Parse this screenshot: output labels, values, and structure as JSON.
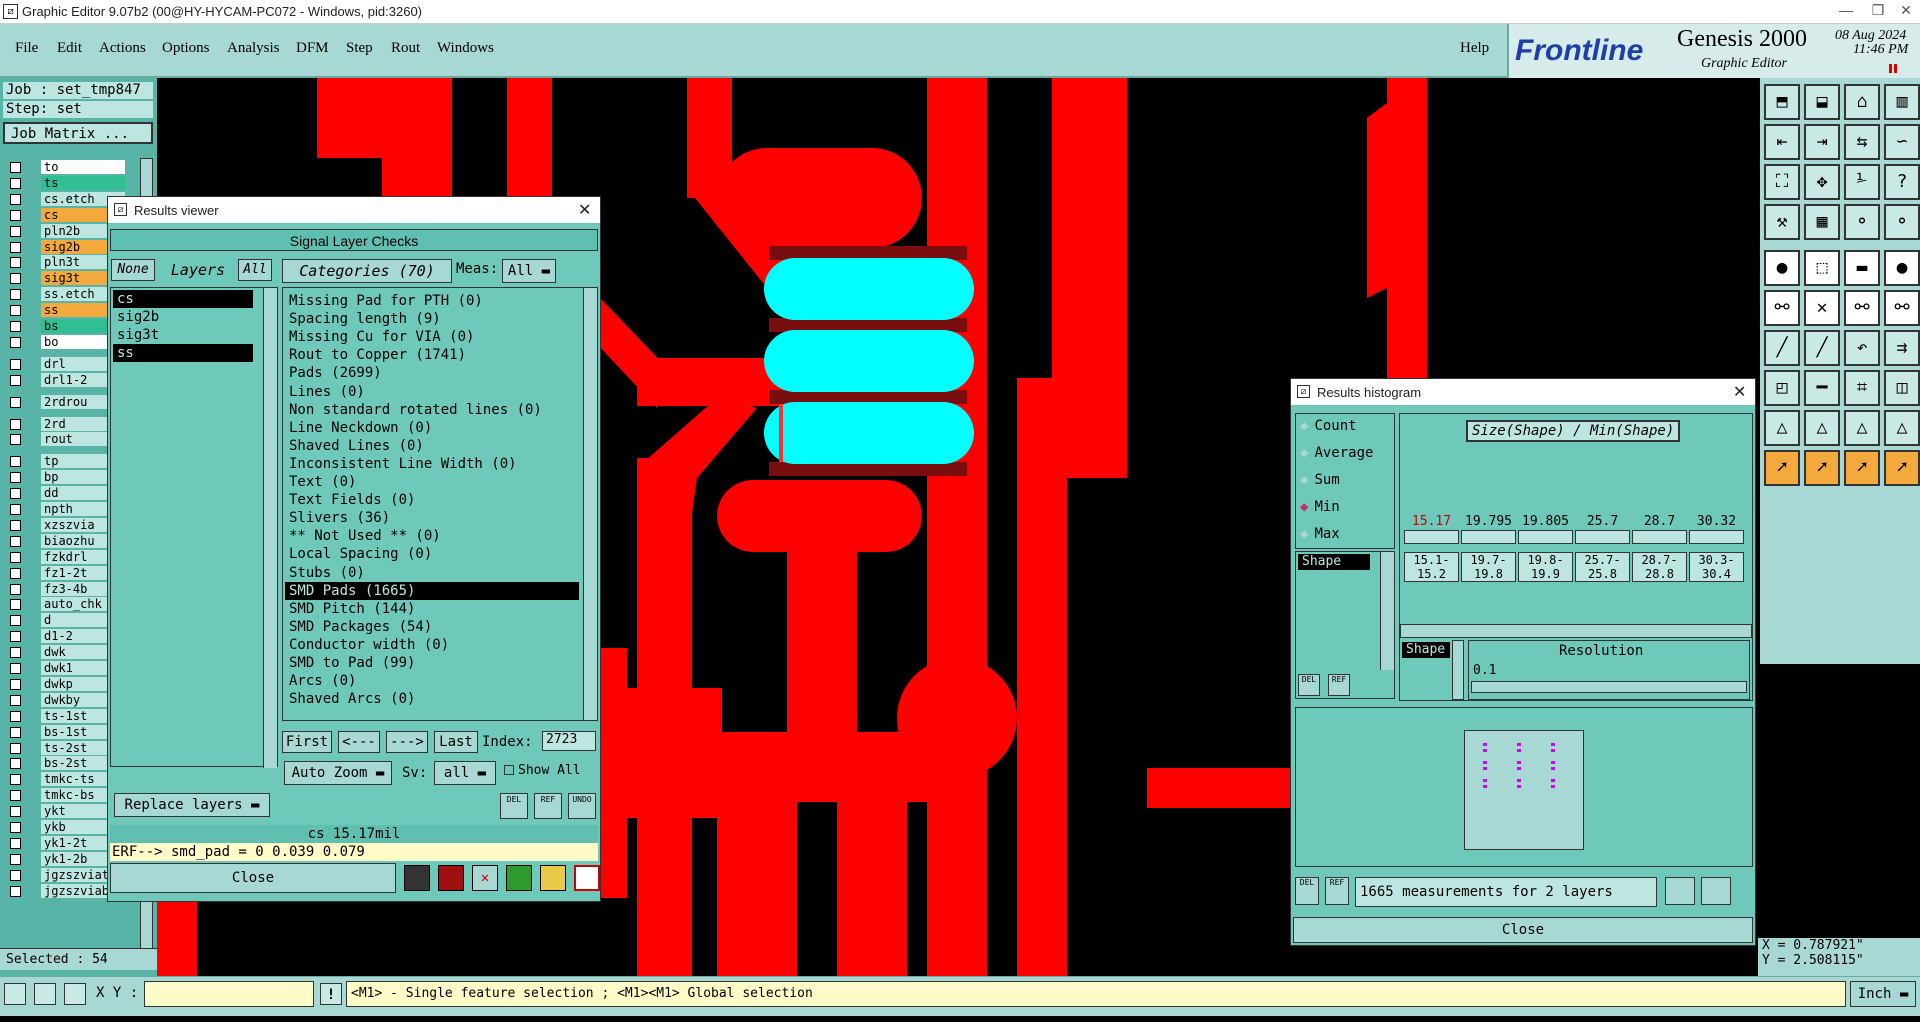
{
  "window": {
    "title": "Graphic Editor 9.07b2 (00@HY-HYCAM-PC072 - Windows, pid:3260)"
  },
  "menubar": {
    "items": [
      "File",
      "Edit",
      "Actions",
      "Options",
      "Analysis",
      "DFM",
      "Step",
      "Rout",
      "Windows"
    ],
    "help": "Help"
  },
  "brand": {
    "logo": "Frontline",
    "product": "Genesis 2000",
    "subtitle": "Graphic Editor",
    "date": "08 Aug 2024",
    "time": "11:46 PM"
  },
  "left_panel": {
    "job": "Job : set_tmp847",
    "step": "Step: set",
    "job_matrix": "Job Matrix ...",
    "layers": [
      {
        "name": "to",
        "color": "#ffffff"
      },
      {
        "name": "ts",
        "color": "#2fbf92"
      },
      {
        "name": "cs.etch",
        "color": "#bde6e0"
      },
      {
        "name": "cs",
        "color": "#f3a93b"
      },
      {
        "name": "pln2b",
        "color": "#bde6e0"
      },
      {
        "name": "sig2b",
        "color": "#f3a93b"
      },
      {
        "name": "pln3t",
        "color": "#bde6e0"
      },
      {
        "name": "sig3t",
        "color": "#f3a93b"
      },
      {
        "name": "ss.etch",
        "color": "#bde6e0"
      },
      {
        "name": "ss",
        "color": "#f3a93b"
      },
      {
        "name": "bs",
        "color": "#2fbf92"
      },
      {
        "name": "bo",
        "color": "#ffffff"
      },
      {
        "name": "drl",
        "color": "#bde6e0"
      },
      {
        "name": "drl1-2",
        "color": "#bde6e0"
      },
      {
        "name": "2rdrou",
        "color": "#bde6e0"
      },
      {
        "name": "2rd",
        "color": "#bde6e0"
      },
      {
        "name": "rout",
        "color": "#bde6e0"
      },
      {
        "name": "tp",
        "color": "#bde6e0"
      },
      {
        "name": "bp",
        "color": "#bde6e0"
      },
      {
        "name": "dd",
        "color": "#bde6e0"
      },
      {
        "name": "npth",
        "color": "#bde6e0"
      },
      {
        "name": "xzszvia",
        "color": "#bde6e0"
      },
      {
        "name": "biaozhu",
        "color": "#bde6e0"
      },
      {
        "name": "fzkdrl",
        "color": "#bde6e0"
      },
      {
        "name": "fz1-2t",
        "color": "#bde6e0"
      },
      {
        "name": "fz3-4b",
        "color": "#bde6e0"
      },
      {
        "name": "auto_chk",
        "color": "#bde6e0"
      },
      {
        "name": "d",
        "color": "#bde6e0"
      },
      {
        "name": "d1-2",
        "color": "#bde6e0"
      },
      {
        "name": "dwk",
        "color": "#bde6e0"
      },
      {
        "name": "dwk1",
        "color": "#bde6e0"
      },
      {
        "name": "dwkp",
        "color": "#bde6e0"
      },
      {
        "name": "dwkby",
        "color": "#bde6e0"
      },
      {
        "name": "ts-1st",
        "color": "#bde6e0"
      },
      {
        "name": "bs-1st",
        "color": "#bde6e0"
      },
      {
        "name": "ts-2st",
        "color": "#bde6e0"
      },
      {
        "name": "bs-2st",
        "color": "#bde6e0"
      },
      {
        "name": "tmkc-ts",
        "color": "#bde6e0"
      },
      {
        "name": "tmkc-bs",
        "color": "#bde6e0"
      },
      {
        "name": "ykt",
        "color": "#bde6e0"
      },
      {
        "name": "ykb",
        "color": "#bde6e0"
      },
      {
        "name": "yk1-2t",
        "color": "#bde6e0"
      },
      {
        "name": "yk1-2b",
        "color": "#bde6e0"
      },
      {
        "name": "jgzszviat",
        "color": "#bde6e0"
      },
      {
        "name": "jgzszviab",
        "color": "#bde6e0"
      }
    ],
    "selected": "Selected : 54"
  },
  "results_viewer": {
    "title": "Results viewer",
    "header": "Signal Layer Checks",
    "none_btn": "None",
    "layers_label": "Layers",
    "all_btn": "All",
    "categories_label": "Categories (70)",
    "meas_label": "Meas:",
    "meas_value": "All",
    "layers": [
      "cs",
      "sig2b",
      "sig3t",
      "ss"
    ],
    "categories": [
      "Missing Pad for PTH (0)",
      "Spacing length (9)",
      "Missing Cu for VIA (0)",
      "Rout to Copper (1741)",
      "Pads (2699)",
      "Lines (0)",
      "Non standard rotated lines (0)",
      "Line Neckdown (0)",
      "Shaved Lines (0)",
      "Inconsistent Line Width (0)",
      "Text (0)",
      "Text Fields (0)",
      "Slivers (36)",
      "** Not Used ** (0)",
      "Local Spacing (0)",
      "Stubs (0)",
      "SMD Pads (1665)",
      "SMD Pitch (144)",
      "SMD Packages (54)",
      "Conductor width (0)",
      "SMD to Pad (99)",
      "Arcs (0)",
      "Shaved Arcs (0)"
    ],
    "selected_category": "SMD Pads (1665)",
    "first": "First",
    "prev": "<---",
    "next": "--->",
    "last": "Last",
    "index_label": "Index:",
    "index_value": "2723",
    "auto_zoom": "Auto Zoom",
    "sv_label": "Sv:",
    "sv_value": "all",
    "show_all": "Show All",
    "replace_layers": "Replace layers",
    "del": "DEL",
    "ref": "REF",
    "undo": "UNDO",
    "info": "cs 15.17mil",
    "erf": "ERF--> smd_pad = 0 0.039 0.079",
    "close": "Close"
  },
  "histogram": {
    "title": "Results histogram",
    "options": [
      "Count",
      "Average",
      "Sum",
      "Min",
      "Max"
    ],
    "selected_option": "Min",
    "shape_label": "Shape",
    "chart_title": "Size(Shape) / Min(Shape)",
    "values": [
      "15.17",
      "19.795",
      "19.805",
      "25.7",
      "28.7",
      "30.32"
    ],
    "ranges": [
      "15.1-\n15.2",
      "19.7-\n19.8",
      "19.8-\n19.9",
      "25.7-\n25.8",
      "28.7-\n28.8",
      "30.3-\n30.4"
    ],
    "resolution_label": "Resolution",
    "resolution_value": "0.1",
    "measurements": "1665 measurements for 2 layers",
    "close": "Close"
  },
  "coords": {
    "x": "X = 0.787921\"",
    "y": "Y = 2.508115\""
  },
  "statusbar": {
    "xy_label": "X Y :",
    "xy_value": "",
    "hint": "<M1> - Single feature selection ; <M1><M1> Global selection",
    "units": "Inch"
  },
  "colors": {
    "copper": "#ff0000",
    "pad_highlight": "#00ffff",
    "panel": "#6ec9bb",
    "menubar": "#a7d8d4"
  }
}
